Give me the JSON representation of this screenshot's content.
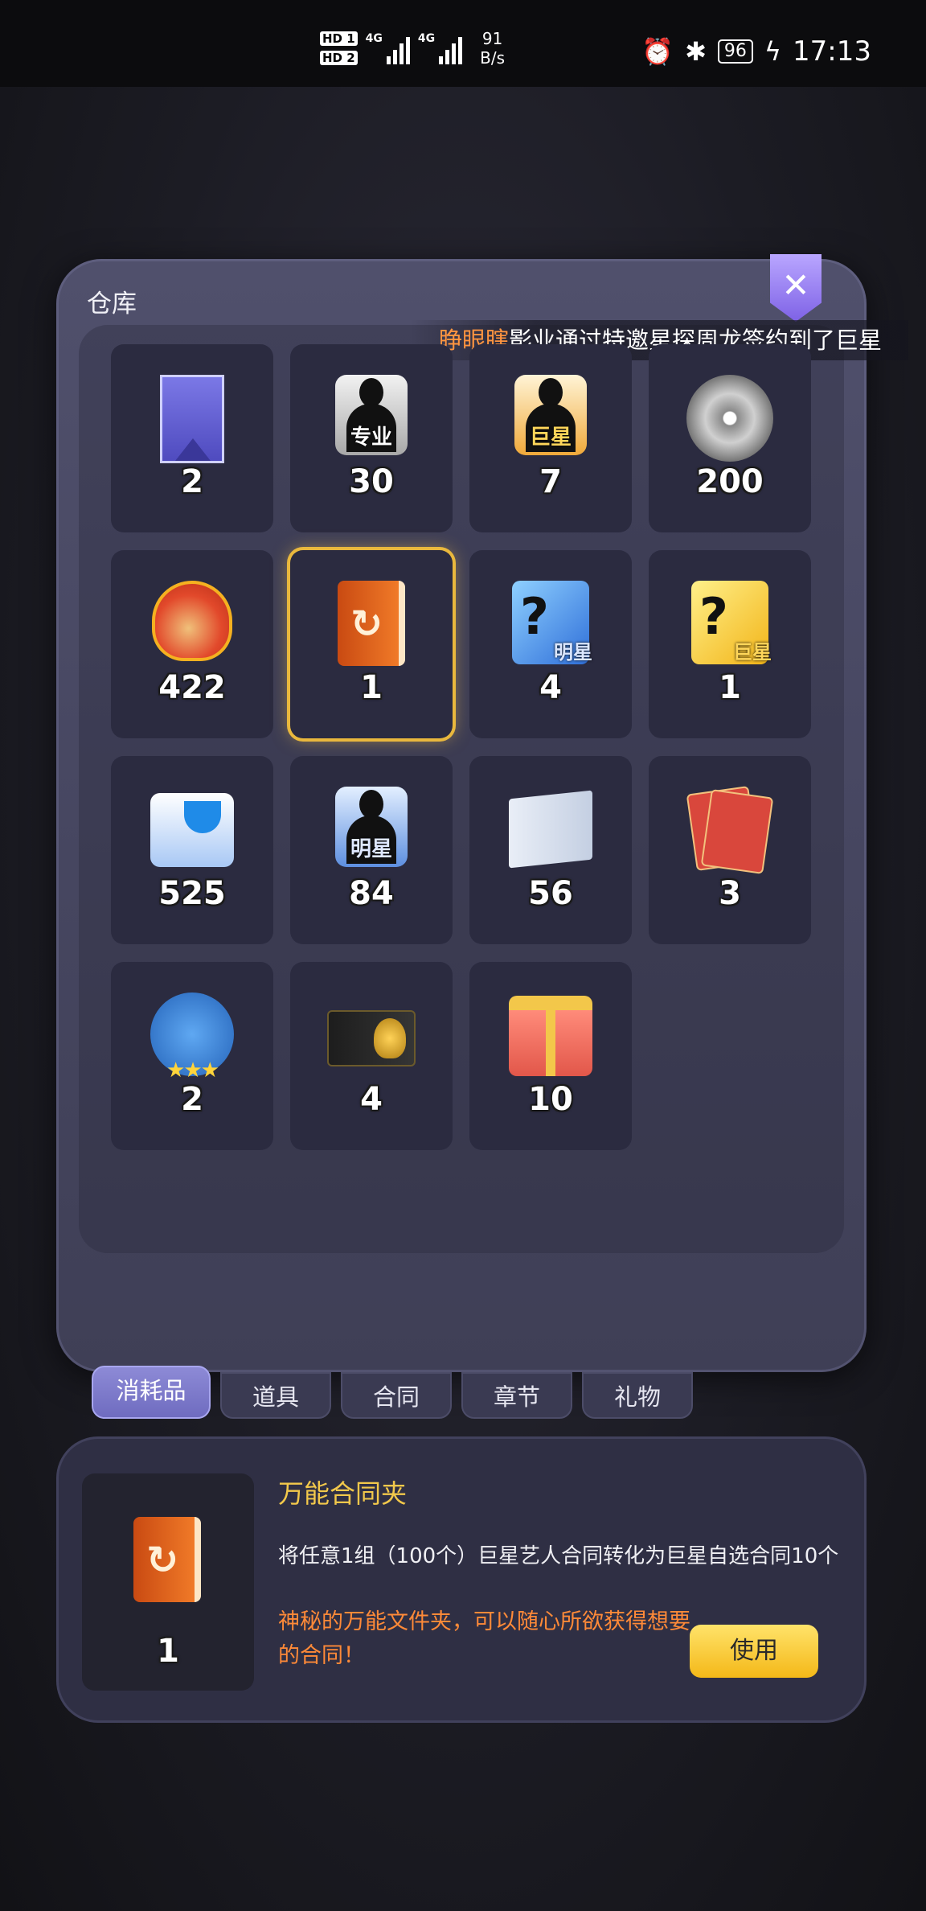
{
  "status_bar": {
    "hd1": "HD 1",
    "hd2": "HD 2",
    "net1": "4G",
    "net2": "4G",
    "speed_value": "91",
    "speed_unit": "B/s",
    "alarm_icon": "alarm-icon",
    "bluetooth_icon": "bluetooth-icon",
    "battery": "96",
    "time": "17:13"
  },
  "panel": {
    "title": "仓库",
    "close_icon": "close-icon",
    "ticker_highlight": "睁眼瞎",
    "ticker_text": "影业通过特邀星探周龙签约到了巨星"
  },
  "items": [
    {
      "icon": "purple-card-icon",
      "count": "2"
    },
    {
      "icon": "professional-contract-icon",
      "tag": "专业",
      "count": "30"
    },
    {
      "icon": "superstar-contract-icon",
      "tag": "巨星",
      "count": "7"
    },
    {
      "icon": "film-reel-icon",
      "count": "200"
    },
    {
      "icon": "lucky-bell-icon",
      "count": "422"
    },
    {
      "icon": "universal-contract-folder-icon",
      "count": "1",
      "selected": true
    },
    {
      "icon": "star-mystery-box-icon",
      "tag": "明星",
      "count": "4"
    },
    {
      "icon": "superstar-mystery-box-icon",
      "tag": "巨星",
      "count": "1"
    },
    {
      "icon": "drink-cup-icon",
      "count": "525"
    },
    {
      "icon": "star-contract-icon",
      "tag": "明星",
      "count": "84"
    },
    {
      "icon": "script-book-icon",
      "count": "56"
    },
    {
      "icon": "red-envelope-icon",
      "count": "3"
    },
    {
      "icon": "team-badge-icon",
      "count": "2"
    },
    {
      "icon": "black-gold-card-icon",
      "count": "4"
    },
    {
      "icon": "gift-box-icon",
      "count": "10"
    }
  ],
  "tabs": [
    {
      "label": "消耗品",
      "active": true
    },
    {
      "label": "道具",
      "active": false
    },
    {
      "label": "合同",
      "active": false
    },
    {
      "label": "章节",
      "active": false
    },
    {
      "label": "礼物",
      "active": false
    }
  ],
  "detail": {
    "icon": "universal-contract-folder-icon",
    "count": "1",
    "name": "万能合同夹",
    "description": "将任意1组（100个）巨星艺人合同转化为巨星自选合同10个",
    "flavor": "神秘的万能文件夹，可以随心所欲获得想要的合同！",
    "use_button": "使用"
  },
  "colors": {
    "accent_gold": "#f2c84b",
    "flavor_orange": "#ff8a38",
    "tab_active": "#8d8ad6"
  }
}
